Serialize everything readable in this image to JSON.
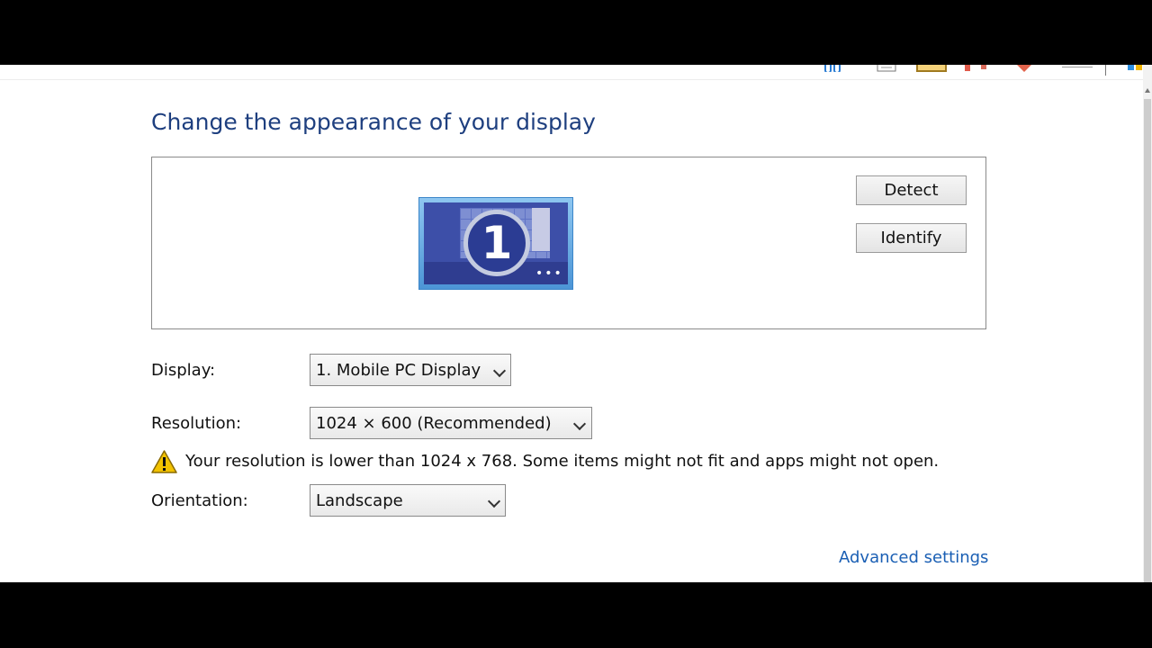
{
  "page": {
    "title": "Change the appearance of your display"
  },
  "monitor_preview": {
    "number": "1"
  },
  "buttons": {
    "detect": "Detect",
    "identify": "Identify"
  },
  "display_row": {
    "label": "Display:",
    "selected": "1. Mobile PC Display"
  },
  "resolution_row": {
    "label": "Resolution:",
    "selected": "1024 × 600 (Recommended)"
  },
  "warning": {
    "icon": "warning-triangle-icon",
    "text": "Your resolution is lower than 1024 x 768. Some items might not fit and apps might not open."
  },
  "orientation_row": {
    "label": "Orientation:",
    "selected": "Landscape"
  },
  "advanced_link": "Advanced settings",
  "colors": {
    "title": "#1e3f7f",
    "link": "#1a5fb4",
    "warning": "#f2c200"
  }
}
